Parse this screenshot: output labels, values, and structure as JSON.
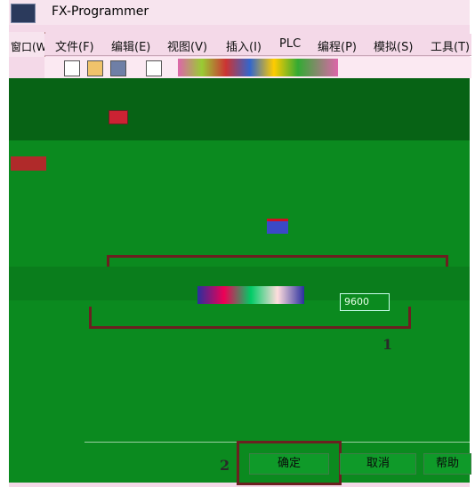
{
  "window": {
    "title": "FX-Programmer"
  },
  "left_tab": {
    "label": "窗口(W"
  },
  "menu": {
    "items": [
      {
        "label": "文件(F)"
      },
      {
        "label": "编辑(E)"
      },
      {
        "label": "视图(V)"
      },
      {
        "label": "插入(I)"
      },
      {
        "label": "PLC"
      },
      {
        "label": "编程(P)"
      },
      {
        "label": "模拟(S)"
      },
      {
        "label": "工具(T)"
      }
    ]
  },
  "dialog": {
    "baud_value": "9600",
    "callout_1": "1",
    "callout_2": "2",
    "buttons": {
      "ok": "确定",
      "cancel": "取消",
      "help": "帮助"
    }
  },
  "colors": {
    "accent_green": "#0b8a1f",
    "frame_pink": "#f4d9e8",
    "callout_red": "#6b2020"
  }
}
